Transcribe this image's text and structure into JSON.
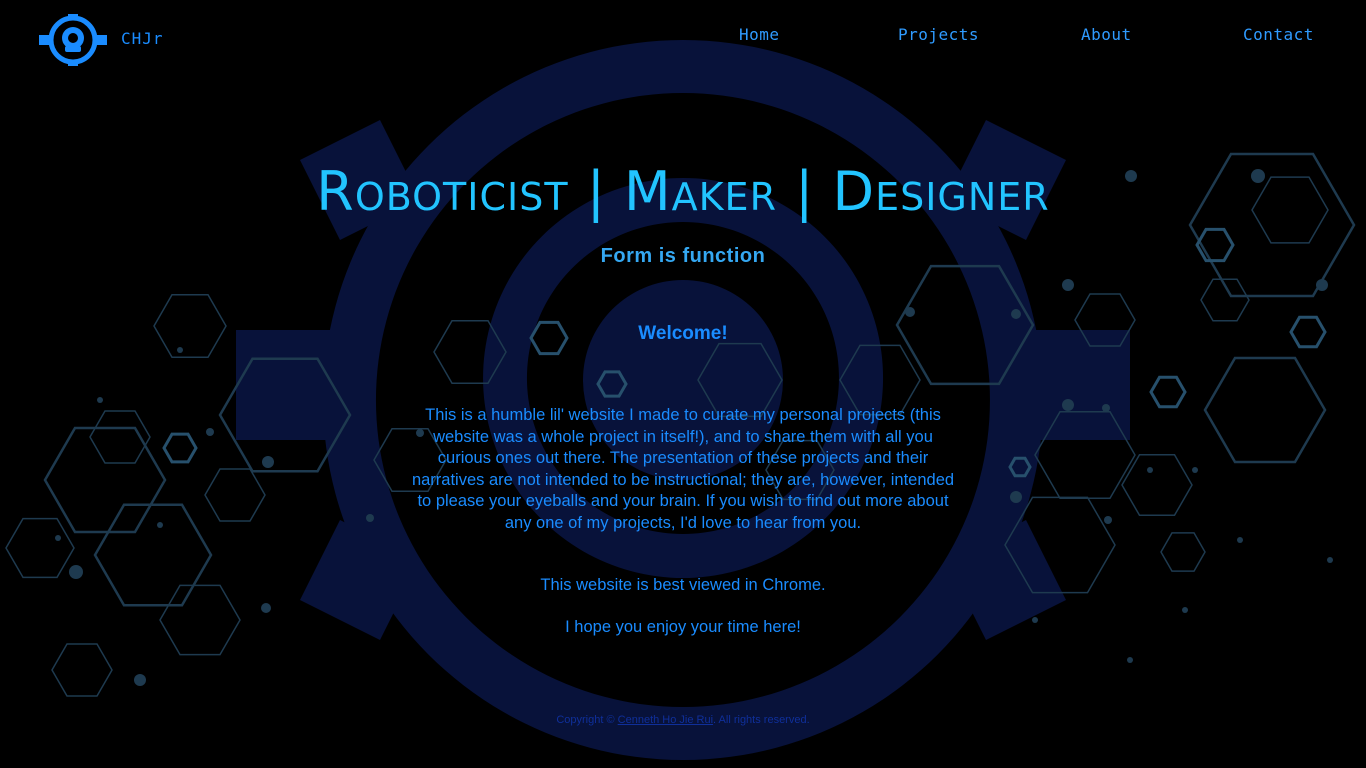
{
  "header": {
    "brand": "CHJr",
    "logo_icon": "gear-robot-head-icon",
    "nav": [
      {
        "label": "Home"
      },
      {
        "label": "Projects"
      },
      {
        "label": "About"
      },
      {
        "label": "Contact"
      }
    ]
  },
  "hero": {
    "title": "Roboticist | Maker | Designer",
    "tagline": "Form is function"
  },
  "intro": {
    "heading": "Welcome!",
    "paragraph": "This is a humble lil' website I made to curate my personal projects (this website was a whole project in itself!), and to share them with all you curious ones out there. The presentation of these projects and their narratives are not intended to be instructional; they are, however, intended to please your eyeballs and your brain. If you wish to find out more about any one of my projects, I'd love to hear from you.",
    "note": "This website is best viewed in Chrome.",
    "closing": "I hope you enjoy your time here!"
  },
  "footer": {
    "prefix": "Copyright ©",
    "author": "Cenneth Ho Jie Rui",
    "suffix": ". All rights reserved."
  },
  "colors": {
    "background": "#000000",
    "accent": "#1a8cff",
    "title": "#22c4ff",
    "hex_pattern": "#1e3a4f",
    "gear_watermark": "#08123a"
  }
}
